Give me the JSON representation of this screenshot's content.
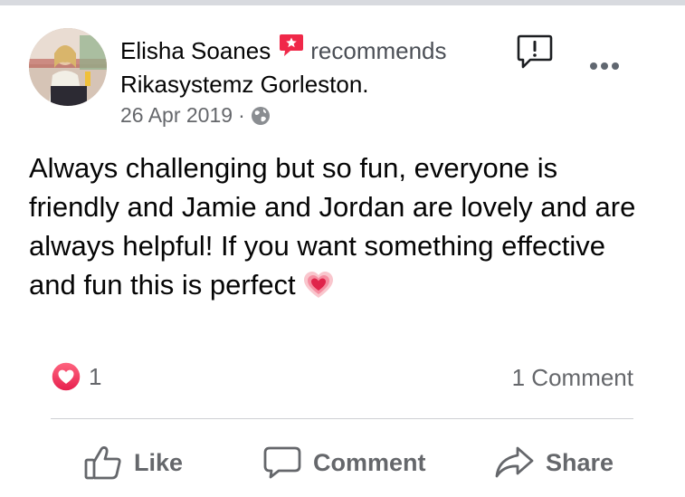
{
  "post": {
    "author_name": "Elisha Soanes",
    "recommends_text": "recommends",
    "page_name": "Rikasystemz Gorleston.",
    "date": "26 Apr 2019",
    "separator": "·",
    "audience_icon": "globe-icon",
    "body_text": "Always challenging but so fun, everyone is friendly and Jamie and Jordan are lovely and are always helpful! If you want something effective and fun this is perfect",
    "body_emoji": "growing-heart-emoji"
  },
  "engagement": {
    "reaction_icon": "love-reaction-icon",
    "reaction_count": "1",
    "comments_label": "1 Comment"
  },
  "actions": {
    "like_label": "Like",
    "comment_label": "Comment",
    "share_label": "Share"
  },
  "colors": {
    "recommend_red": "#f02849",
    "secondary_text": "#65676b",
    "divider": "#ced0d4",
    "top_band": "#d8dadf"
  }
}
